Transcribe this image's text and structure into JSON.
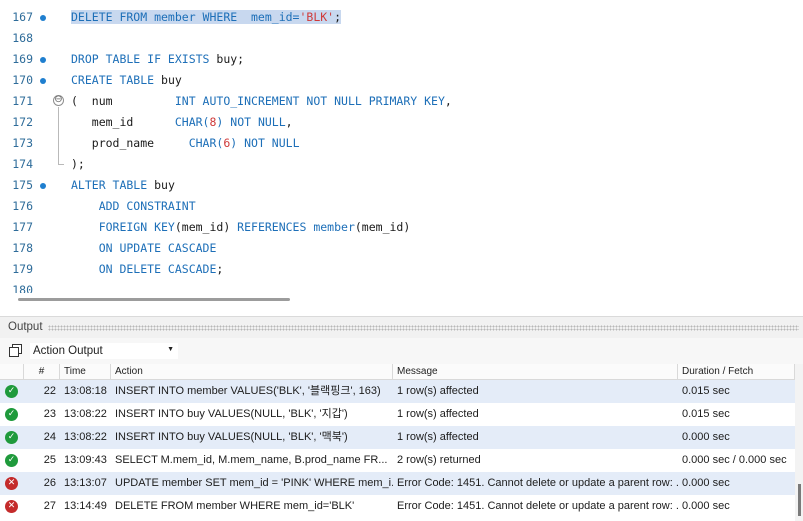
{
  "editor": {
    "lines": [
      {
        "num": "167",
        "marker": true,
        "fold": "",
        "segments": [
          {
            "t": "DELETE FROM member WHERE  mem_id=",
            "k": "kw",
            "h": true
          },
          {
            "t": "'BLK'",
            "k": "str",
            "h": true
          },
          {
            "t": ";",
            "k": "",
            "h": true
          }
        ]
      },
      {
        "num": "168",
        "marker": false,
        "fold": "",
        "segments": []
      },
      {
        "num": "169",
        "marker": true,
        "fold": "",
        "segments": [
          {
            "t": "DROP TABLE IF EXISTS ",
            "k": "kw"
          },
          {
            "t": "buy;",
            "k": ""
          }
        ]
      },
      {
        "num": "170",
        "marker": true,
        "fold": "",
        "segments": [
          {
            "t": "CREATE TABLE ",
            "k": "kw"
          },
          {
            "t": "buy",
            "k": ""
          }
        ]
      },
      {
        "num": "171",
        "marker": false,
        "fold": "⊖",
        "segments": [
          {
            "t": "(  num         ",
            "k": ""
          },
          {
            "t": "INT AUTO_INCREMENT NOT NULL PRIMARY KEY",
            "k": "kw"
          },
          {
            "t": ",",
            "k": ""
          }
        ]
      },
      {
        "num": "172",
        "marker": false,
        "fold": "",
        "segments": [
          {
            "t": "   mem_id      ",
            "k": ""
          },
          {
            "t": "CHAR(",
            "k": "kw"
          },
          {
            "t": "8",
            "k": "num"
          },
          {
            "t": ") NOT NULL",
            "k": "kw"
          },
          {
            "t": ",",
            "k": ""
          }
        ]
      },
      {
        "num": "173",
        "marker": false,
        "fold": "",
        "segments": [
          {
            "t": "   prod_name     ",
            "k": ""
          },
          {
            "t": "CHAR(",
            "k": "kw"
          },
          {
            "t": "6",
            "k": "num"
          },
          {
            "t": ") NOT NULL",
            "k": "kw"
          }
        ]
      },
      {
        "num": "174",
        "marker": false,
        "fold": "",
        "segments": [
          {
            "t": ");",
            "k": ""
          }
        ]
      },
      {
        "num": "175",
        "marker": true,
        "fold": "",
        "segments": [
          {
            "t": "ALTER TABLE ",
            "k": "kw"
          },
          {
            "t": "buy",
            "k": ""
          }
        ]
      },
      {
        "num": "176",
        "marker": false,
        "fold": "",
        "segments": [
          {
            "t": "    ADD CONSTRAINT",
            "k": "kw"
          }
        ]
      },
      {
        "num": "177",
        "marker": false,
        "fold": "",
        "segments": [
          {
            "t": "    FOREIGN KEY",
            "k": "kw"
          },
          {
            "t": "(mem_id) ",
            "k": ""
          },
          {
            "t": "REFERENCES member",
            "k": "kw"
          },
          {
            "t": "(mem_id)",
            "k": ""
          }
        ]
      },
      {
        "num": "178",
        "marker": false,
        "fold": "",
        "segments": [
          {
            "t": "    ON UPDATE CASCADE",
            "k": "kw"
          }
        ]
      },
      {
        "num": "179",
        "marker": false,
        "fold": "",
        "segments": [
          {
            "t": "    ON DELETE CASCADE",
            "k": "kw"
          },
          {
            "t": ";",
            "k": ""
          }
        ]
      },
      {
        "num": "180",
        "marker": false,
        "fold": "",
        "segments": []
      }
    ]
  },
  "output": {
    "title": "Output",
    "selector": "Action Output",
    "columns": [
      "#",
      "Time",
      "Action",
      "Message",
      "Duration / Fetch"
    ],
    "rows": [
      {
        "status": "ok",
        "num": "22",
        "time": "13:08:18",
        "action": "INSERT INTO member VALUES('BLK', '블랙핑크', 163)",
        "message": "1 row(s) affected",
        "duration": "0.015 sec"
      },
      {
        "status": "ok",
        "num": "23",
        "time": "13:08:22",
        "action": "INSERT INTO buy VALUES(NULL, 'BLK', '지갑')",
        "message": "1 row(s) affected",
        "duration": "0.015 sec"
      },
      {
        "status": "ok",
        "num": "24",
        "time": "13:08:22",
        "action": "INSERT INTO buy VALUES(NULL, 'BLK', '맥북')",
        "message": "1 row(s) affected",
        "duration": "0.000 sec"
      },
      {
        "status": "ok",
        "num": "25",
        "time": "13:09:43",
        "action": "SELECT M.mem_id, M.mem_name, B.prod_name     FR...",
        "message": "2 row(s) returned",
        "duration": "0.000 sec / 0.000 sec"
      },
      {
        "status": "err",
        "num": "26",
        "time": "13:13:07",
        "action": "UPDATE member SET mem_id = 'PINK' WHERE mem_i...",
        "message": "Error Code: 1451. Cannot delete or update a parent row: ...",
        "duration": "0.000 sec"
      },
      {
        "status": "err",
        "num": "27",
        "time": "13:14:49",
        "action": "DELETE FROM member WHERE  mem_id='BLK'",
        "message": "Error Code: 1451. Cannot delete or update a parent row: ...",
        "duration": "0.000 sec"
      }
    ]
  }
}
